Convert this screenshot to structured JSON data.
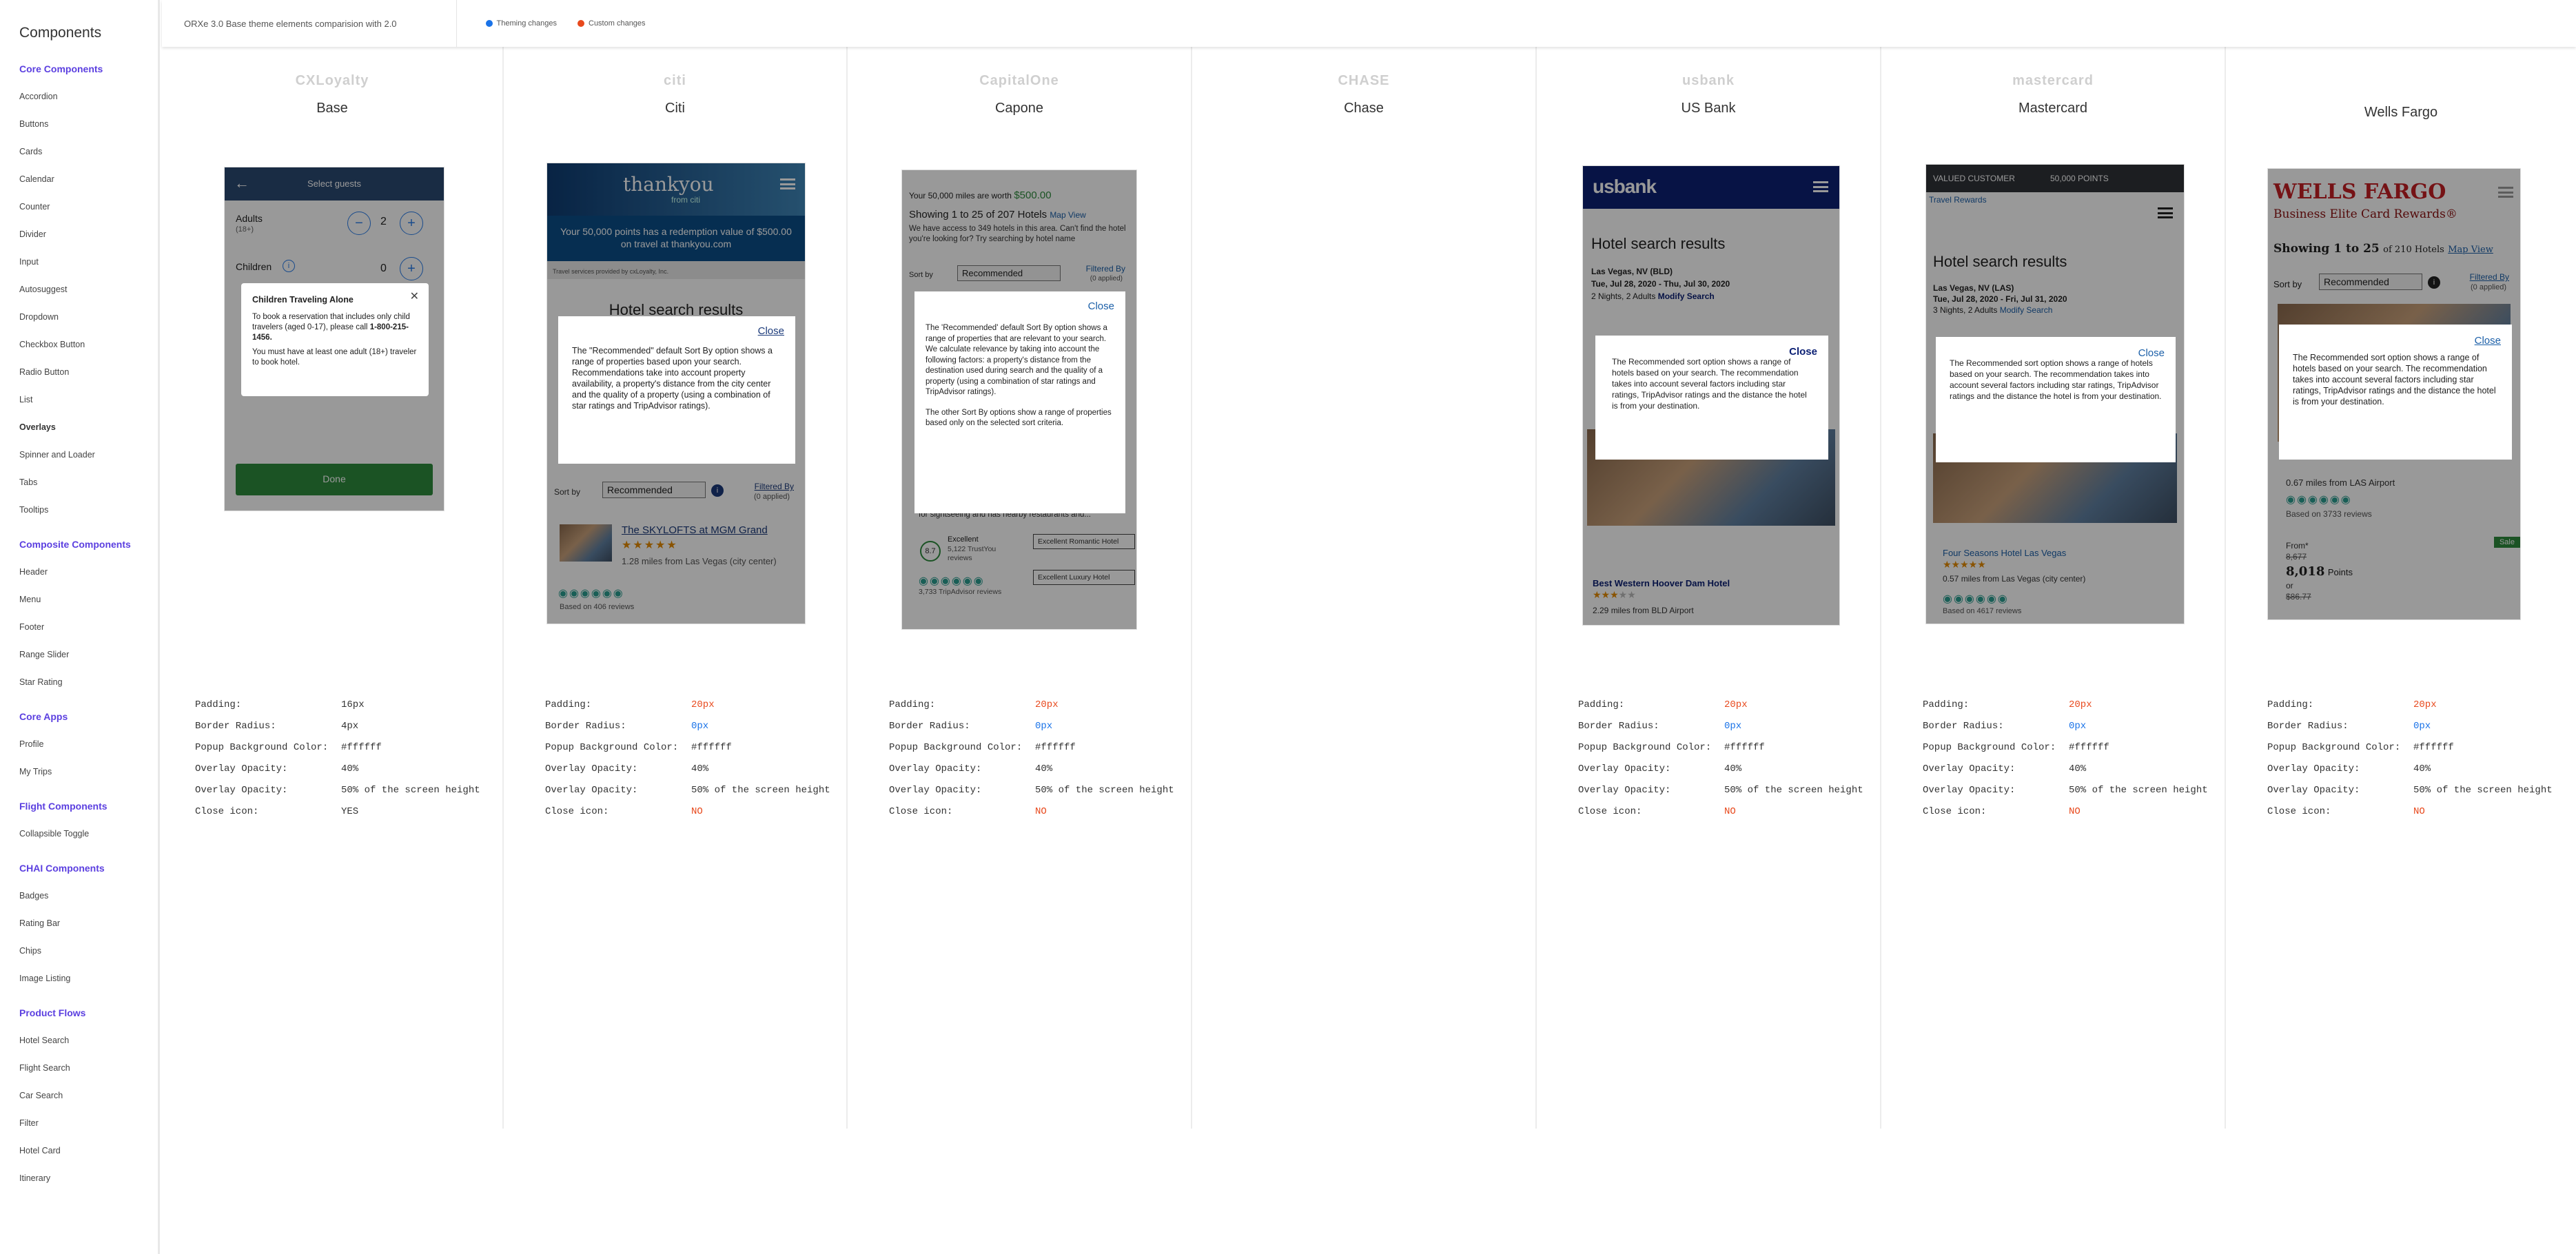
{
  "sidebar": {
    "title": "Components",
    "groups": [
      {
        "label": "Core Components",
        "items": [
          "Accordion",
          "Buttons",
          "Cards",
          "Calendar",
          "Counter",
          "Divider",
          "Input",
          "Autosuggest",
          "Dropdown",
          "Checkbox Button",
          "Radio Button",
          "List",
          "Overlays",
          "Spinner and Loader",
          "Tabs",
          "Tooltips"
        ]
      },
      {
        "label": "Composite Components",
        "items": [
          "Header",
          "Menu",
          "Footer",
          "Range Slider",
          "Star Rating"
        ]
      },
      {
        "label": "Core Apps",
        "items": [
          "Profile",
          "My Trips"
        ]
      },
      {
        "label": "Flight Components",
        "items": [
          "Collapsible Toggle"
        ]
      },
      {
        "label": "CHAI Components",
        "items": [
          "Badges",
          "Rating Bar",
          "Chips",
          "Image Listing"
        ]
      },
      {
        "label": "Product Flows",
        "items": [
          "Hotel Search",
          "Flight Search",
          "Car Search",
          "Filter",
          "Hotel Card",
          "Itinerary"
        ]
      }
    ],
    "active_item": "Overlays"
  },
  "topbar": {
    "title": "ORXe 3.0 Base theme elements comparision with 2.0",
    "legend": [
      {
        "label": "Theming changes",
        "color": "#1a73e8"
      },
      {
        "label": "Custom changes",
        "color": "#e8491d"
      }
    ]
  },
  "prop_labels": [
    "Padding:",
    "Border Radius:",
    "Popup Background Color:",
    "Overlay Opacity:",
    "Overlay Opacity:",
    "Close icon:"
  ],
  "columns": [
    {
      "id": "base",
      "logo": "CXLoyalty",
      "name": "Base",
      "props": [
        {
          "v": "16px",
          "c": "normal"
        },
        {
          "v": "4px",
          "c": "normal"
        },
        {
          "v": "#ffffff",
          "c": "normal"
        },
        {
          "v": "40%",
          "c": "normal"
        },
        {
          "v": "50% of the screen height",
          "c": "normal"
        },
        {
          "v": "YES",
          "c": "normal"
        }
      ]
    },
    {
      "id": "citi",
      "logo": "citi",
      "name": "Citi",
      "props": [
        {
          "v": "20px",
          "c": "orange"
        },
        {
          "v": "0px",
          "c": "blue"
        },
        {
          "v": "#ffffff",
          "c": "normal"
        },
        {
          "v": "40%",
          "c": "normal"
        },
        {
          "v": "50% of the screen height",
          "c": "normal"
        },
        {
          "v": "NO",
          "c": "orange"
        }
      ]
    },
    {
      "id": "capone",
      "logo": "CapitalOne",
      "name": "Capone",
      "props": [
        {
          "v": "20px",
          "c": "orange"
        },
        {
          "v": "0px",
          "c": "blue"
        },
        {
          "v": "#ffffff",
          "c": "normal"
        },
        {
          "v": "40%",
          "c": "normal"
        },
        {
          "v": "50% of the screen height",
          "c": "normal"
        },
        {
          "v": "NO",
          "c": "orange"
        }
      ]
    },
    {
      "id": "chase",
      "logo": "CHASE",
      "name": "Chase",
      "props": []
    },
    {
      "id": "usbank",
      "logo": "usbank",
      "name": "US Bank",
      "props": [
        {
          "v": "20px",
          "c": "orange"
        },
        {
          "v": "0px",
          "c": "blue"
        },
        {
          "v": "#ffffff",
          "c": "normal"
        },
        {
          "v": "40%",
          "c": "normal"
        },
        {
          "v": "50% of the screen height",
          "c": "normal"
        },
        {
          "v": "NO",
          "c": "orange"
        }
      ]
    },
    {
      "id": "mastercard",
      "logo": "mastercard",
      "name": "Mastercard",
      "props": [
        {
          "v": "20px",
          "c": "orange"
        },
        {
          "v": "0px",
          "c": "blue"
        },
        {
          "v": "#ffffff",
          "c": "normal"
        },
        {
          "v": "40%",
          "c": "normal"
        },
        {
          "v": "50% of the screen height",
          "c": "normal"
        },
        {
          "v": "NO",
          "c": "orange"
        }
      ]
    },
    {
      "id": "wellsfargo",
      "logo": "",
      "name": "Wells Fargo",
      "props": [
        {
          "v": "20px",
          "c": "orange"
        },
        {
          "v": "0px",
          "c": "blue"
        },
        {
          "v": "#ffffff",
          "c": "normal"
        },
        {
          "v": "40%",
          "c": "normal"
        },
        {
          "v": "50% of the screen height",
          "c": "normal"
        },
        {
          "v": "NO",
          "c": "orange"
        }
      ]
    }
  ],
  "shots": {
    "base": {
      "header": "Select guests",
      "adults_label": "Adults",
      "adults_sub": "(18+)",
      "adults_count": "2",
      "children_label": "Children",
      "children_count": "0",
      "popup_title": "Children Traveling Alone",
      "popup_text1": "To book a reservation that includes only child travelers (aged 0-17), please call",
      "popup_phone": "1-800-215-1456.",
      "popup_text2": "You must have at least one adult (18+) traveler to book hotel.",
      "done": "Done"
    },
    "citi": {
      "brand": "thankyou",
      "brand_sub": "from citi",
      "banner": "Your 50,000 points has a redemption value of $500.00 on travel at thankyou.com",
      "provider": "Travel services provided by cxLoyalty, Inc.",
      "heading": "Hotel search results",
      "close": "Close",
      "popup": "The \"Recommended\" default Sort By option shows a range of properties based upon your search. Recommendations take into account property availability, a property's distance from the city center and the quality of a property (using a combination of star ratings and TripAdvisor ratings).",
      "sort_label": "Sort by",
      "sort_value": "Recommended",
      "filtered": "Filtered By",
      "applied": "(0 applied)",
      "hotel": "The SKYLOFTS at MGM Grand",
      "distance": "1.28 miles from Las Vegas (city center)",
      "reviews": "Based on 406 reviews"
    },
    "capone": {
      "miles_text": "Your 50,000 miles are worth",
      "miles_value": "$500.00",
      "showing": "Showing 1 to 25 of 207 Hotels",
      "map": "Map View",
      "access": "We have access to 349 hotels in this area. Can't find the hotel you're looking for? Try searching by hotel name",
      "sort_label": "Sort by",
      "sort_value": "Recommended",
      "filtered": "Filtered By",
      "applied": "(0 applied)",
      "close": "Close",
      "popup1": "The 'Recommended' default Sort By option shows a range of properties that are relevant to your search. We calculate relevance by taking into account the following factors: a property's distance from the destination used during search and the quality of a property (using a combination of star ratings and TripAdvisor ratings).",
      "popup2": "The other Sort By options show a range of properties based only on the selected sort criteria.",
      "snippet": "for sightseeing and has nearby restaurants and...",
      "score": "8.7",
      "excellent": "Excellent",
      "trust": "5,122 TrustYou reviews",
      "tag1": "Excellent Romantic Hotel",
      "tag2": "Excellent Luxury Hotel",
      "ta_reviews": "3,733 TripAdvisor reviews"
    },
    "usbank": {
      "brand": "usbank",
      "heading": "Hotel search results",
      "location": "Las Vegas, NV (BLD)",
      "dates": "Tue, Jul 28, 2020 - Thu, Jul 30, 2020",
      "guests": "2 Nights, 2 Adults",
      "modify": "Modify Search",
      "close": "Close",
      "popup": "The Recommended sort option shows a range of hotels based on your search. The recommendation takes into account several factors including star ratings, TripAdvisor ratings and the distance the hotel is from your destination.",
      "hotel": "Best Western Hoover Dam Hotel",
      "distance": "2.29 miles from BLD Airport"
    },
    "mastercard": {
      "valued": "VALUED CUSTOMER",
      "points": "50,000 POINTS",
      "travel_rewards": "Travel Rewards",
      "heading": "Hotel search results",
      "location": "Las Vegas, NV (LAS)",
      "dates": "Tue, Jul 28, 2020 - Fri, Jul 31, 2020",
      "guests": "3 Nights, 2 Adults",
      "modify": "Modify Search",
      "close": "Close",
      "popup": "The Recommended sort option shows a range of hotels based on your search. The recommendation takes into account several factors including star ratings, TripAdvisor ratings and the distance the hotel is from your destination.",
      "hotel": "Four Seasons Hotel Las Vegas",
      "distance": "0.57 miles from Las Vegas (city center)",
      "reviews": "Based on 4617 reviews"
    },
    "wellsfargo": {
      "brand": "WELLS FARGO",
      "sub": "Business Elite Card Rewards®",
      "showing": "Showing 1 to 25",
      "of_hotels": "of 210 Hotels",
      "map": "Map View",
      "sort_label": "Sort by",
      "sort_value": "Recommended",
      "filtered": "Filtered By",
      "applied": "(0 applied)",
      "close": "Close",
      "popup": "The Recommended sort option shows a range of hotels based on your search. The recommendation takes into account several factors including star ratings, TripAdvisor ratings and the distance the hotel is from your destination.",
      "distance": "0.67 miles from LAS Airport",
      "reviews": "Based on 3733 reviews",
      "sale": "Sale",
      "from": "From*",
      "old_points": "8,677",
      "new_points": "8,018",
      "points_label": "Points",
      "or": "or",
      "old_price": "$86.77"
    }
  }
}
